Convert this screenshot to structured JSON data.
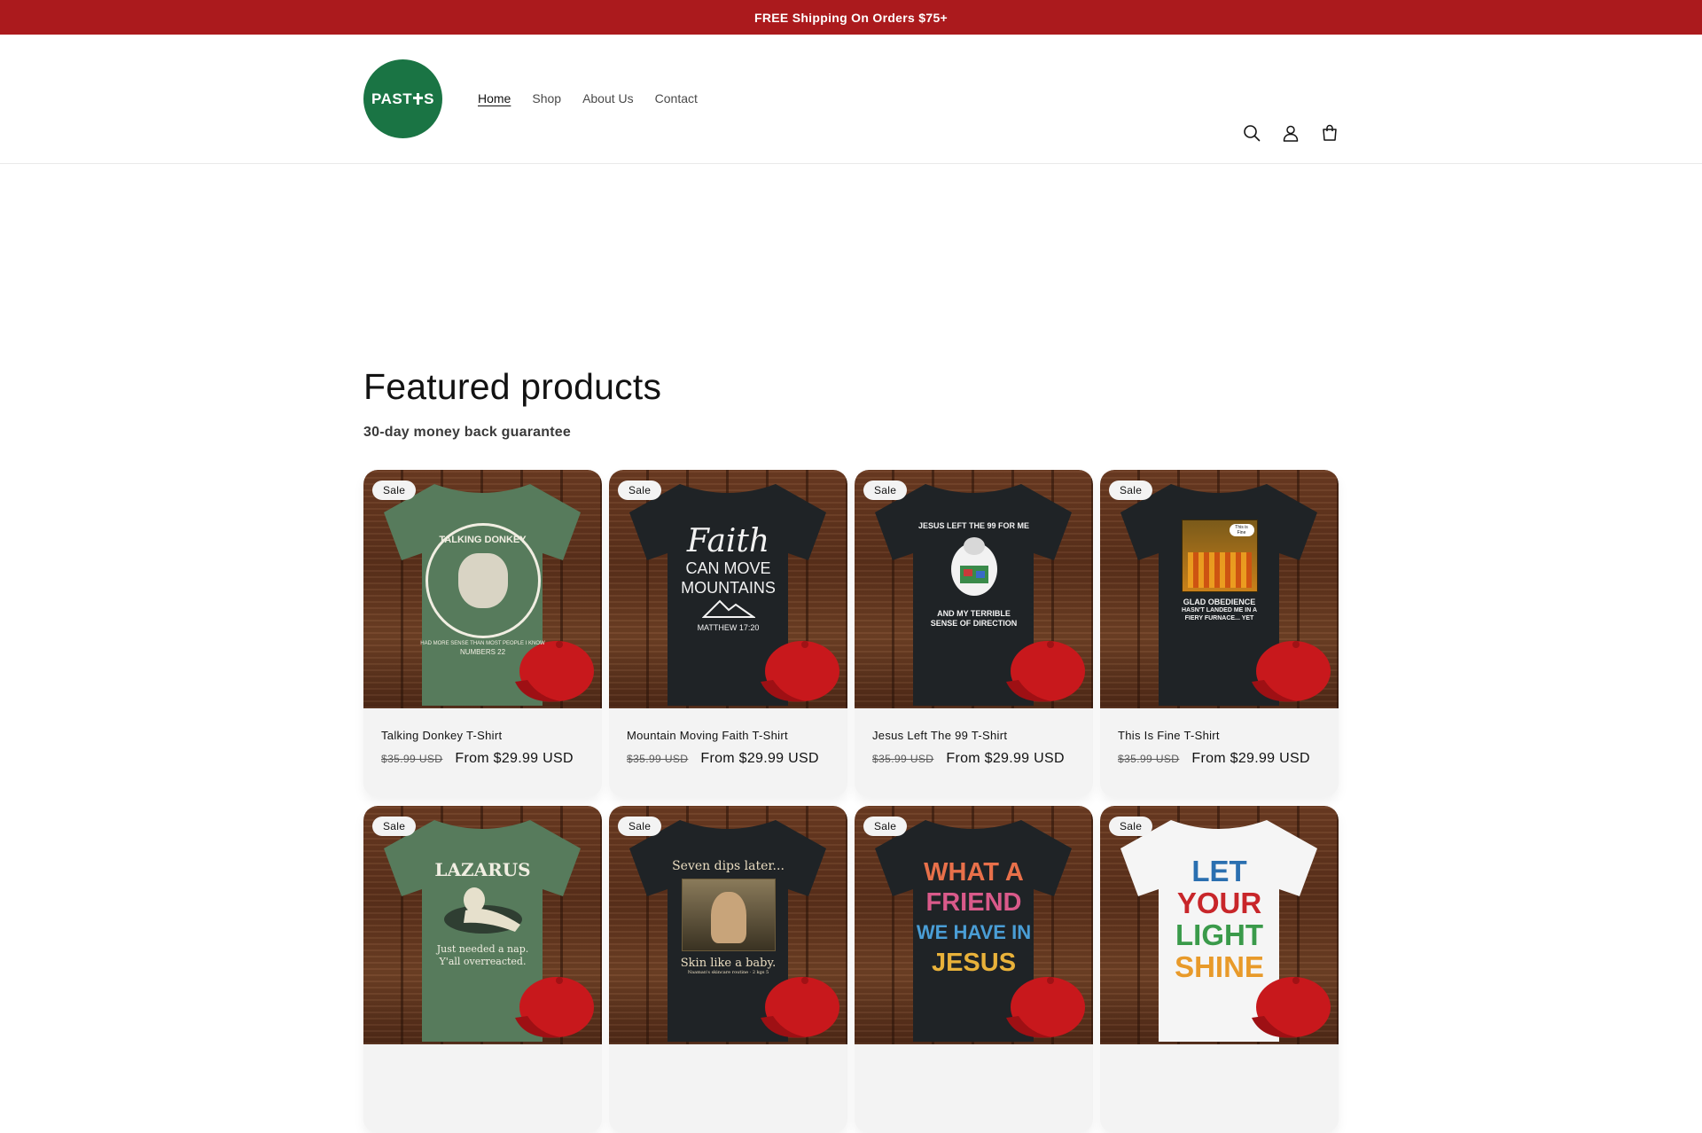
{
  "announcement": "FREE Shipping On Orders $75+",
  "brand": {
    "logo_text_left": "PAST",
    "logo_text_right": "S",
    "logo_color": "#1a7444"
  },
  "colors": {
    "announcement_bg": "#ab1a1d",
    "card_bg": "#f3f3f3"
  },
  "nav": [
    {
      "label": "Home",
      "active": true
    },
    {
      "label": "Shop"
    },
    {
      "label": "About Us"
    },
    {
      "label": "Contact"
    }
  ],
  "header_icons": [
    "search-icon",
    "account-icon",
    "cart-icon"
  ],
  "section": {
    "title": "Featured products",
    "subtitle": "30-day money back guarantee"
  },
  "products": [
    {
      "badge": "Sale",
      "name": "Talking Donkey T-Shirt",
      "old_price": "$35.99 USD",
      "price": "From $29.99 USD",
      "shirt_color": "#577b5c",
      "print": {
        "lines": [
          "TALKING DONKEY",
          "HAD MORE SENSE THAN MOST PEOPLE I KNOW",
          "NUMBERS 22"
        ],
        "color": "#f1eee2"
      }
    },
    {
      "badge": "Sale",
      "name": "Mountain Moving Faith T-Shirt",
      "old_price": "$35.99 USD",
      "price": "From $29.99 USD",
      "shirt_color": "#1f2326",
      "print": {
        "lines": [
          "Faith",
          "CAN MOVE",
          "MOUNTAINS",
          "MATTHEW 17:20"
        ],
        "color": "#f2f2f2"
      }
    },
    {
      "badge": "Sale",
      "name": "Jesus Left The 99 T-Shirt",
      "old_price": "$35.99 USD",
      "price": "From $29.99 USD",
      "shirt_color": "#1f2326",
      "print": {
        "lines": [
          "JESUS LEFT THE 99 FOR ME",
          "AND MY TERRIBLE",
          "SENSE OF DIRECTION"
        ],
        "color": "#f2f2f2"
      }
    },
    {
      "badge": "Sale",
      "name": "This Is Fine T-Shirt",
      "old_price": "$35.99 USD",
      "price": "From $29.99 USD",
      "shirt_color": "#1f2326",
      "print": {
        "lines": [
          "This is Fine",
          "GLAD OBEDIENCE",
          "HASN'T LANDED ME IN A",
          "FIERY FURNACE... YET"
        ],
        "color": "#f2f2f2"
      }
    },
    {
      "badge": "Sale",
      "shirt_color": "#577b5c",
      "print": {
        "lines": [
          "LAZARUS",
          "Just needed a nap.",
          "Y'all overreacted."
        ],
        "color": "#f1eee2"
      }
    },
    {
      "badge": "Sale",
      "shirt_color": "#1f2326",
      "print": {
        "lines": [
          "Seven dips later...",
          "Skin like a baby.",
          "Naaman's skincare routine · 2 kgs 5"
        ],
        "color": "#e9dcc0"
      }
    },
    {
      "badge": "Sale",
      "shirt_color": "#1f2326",
      "print": {
        "lines": [
          "WHAT A",
          "FRIEND",
          "WE HAVE IN",
          "JESUS"
        ],
        "color": "#e8704a"
      }
    },
    {
      "badge": "Sale",
      "shirt_color": "#f5f5f5",
      "print": {
        "lines": [
          "LET",
          "YOUR",
          "LIGHT",
          "SHINE"
        ],
        "color": "#2a6fb0"
      }
    }
  ]
}
